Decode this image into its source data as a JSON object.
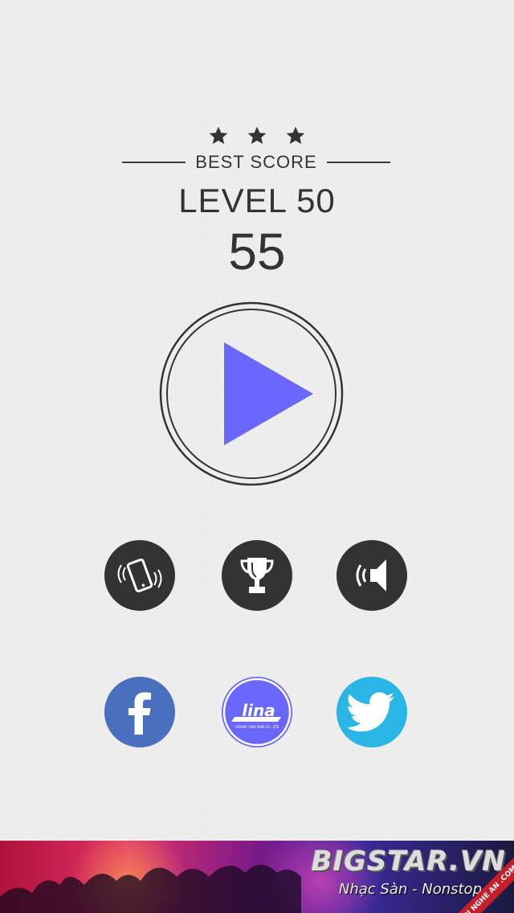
{
  "stars": {
    "count": 3,
    "color": "#333333"
  },
  "best_score": {
    "label": "BEST SCORE"
  },
  "level": {
    "label": "LEVEL",
    "number": "50"
  },
  "score": {
    "value": "55"
  },
  "play": {
    "icon": "play-icon",
    "ring_color": "#333333",
    "triangle_color": "#6a67ff"
  },
  "controls": [
    {
      "icon": "vibrate-phone-icon"
    },
    {
      "icon": "trophy-icon"
    },
    {
      "icon": "sound-on-icon"
    }
  ],
  "social": {
    "facebook": {
      "icon": "facebook-icon",
      "color": "#4a6fbf",
      "glyph": "f"
    },
    "lina": {
      "icon": "lina-logo-icon",
      "color": "#6a67ff",
      "logo_text": "lina",
      "logo_subtext": "HOANG LINH NAM CO., LTD"
    },
    "twitter": {
      "icon": "twitter-icon",
      "color": "#29b6e6"
    }
  },
  "banner": {
    "brand": "BIGSTAR.VN",
    "tagline": "Nhạc Sàn - Nonstop",
    "ribbon": "TEEN NGHE AN .COM"
  }
}
